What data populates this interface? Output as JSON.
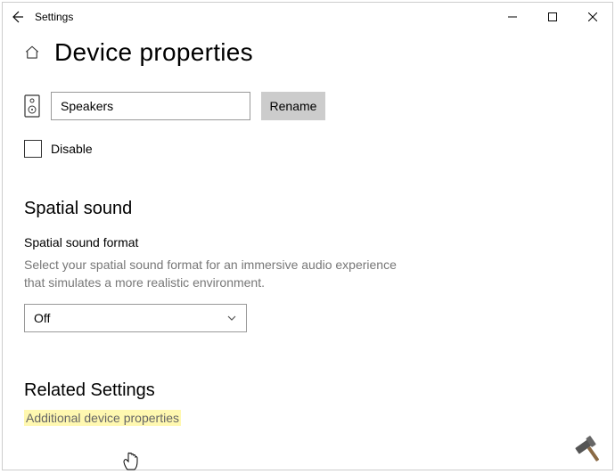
{
  "titlebar": {
    "app_title": "Settings"
  },
  "page": {
    "title": "Device properties"
  },
  "device": {
    "name_value": "Speakers",
    "rename_label": "Rename"
  },
  "disable": {
    "label": "Disable",
    "checked": false
  },
  "spatial": {
    "section_title": "Spatial sound",
    "field_label": "Spatial sound format",
    "description": "Select your spatial sound format for an immersive audio experience that simulates a more realistic environment.",
    "selected": "Off"
  },
  "related": {
    "section_title": "Related Settings",
    "link_label": "Additional device properties"
  }
}
